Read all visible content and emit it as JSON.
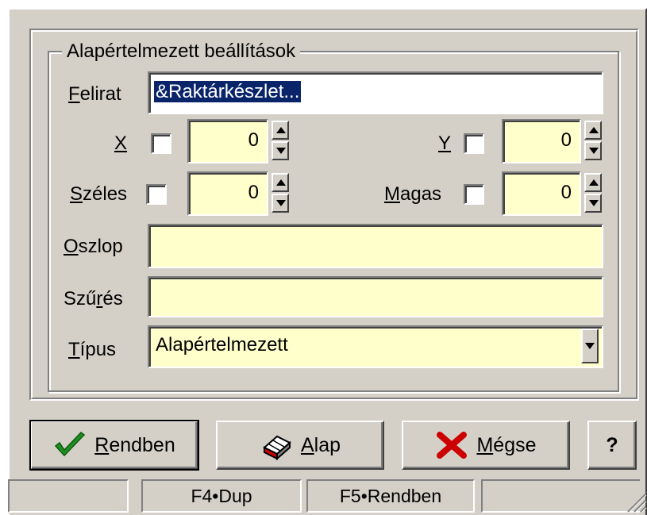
{
  "group": {
    "title": "Alapértelmezett beállítások"
  },
  "fields": {
    "felirat": {
      "label_underlined": "F",
      "label_rest": "elirat",
      "value": "&Raktárkészlet..."
    },
    "x": {
      "label_underlined": "X",
      "label_rest": "",
      "checked": false,
      "value": "0"
    },
    "y": {
      "label_underlined": "Y",
      "label_rest": "",
      "checked": false,
      "value": "0"
    },
    "szeles": {
      "label_underlined": "S",
      "label_rest": "zéles",
      "checked": false,
      "value": "0"
    },
    "magas": {
      "label_underlined": "M",
      "label_rest": "agas",
      "checked": false,
      "value": "0"
    },
    "oszlop": {
      "label_underlined": "O",
      "label_rest": "szlop",
      "value": ""
    },
    "szures": {
      "label_prefix": "Szű",
      "label_underlined": "r",
      "label_rest": "és",
      "value": ""
    },
    "tipus": {
      "label_underlined": "T",
      "label_rest": "ípus",
      "value": "Alapértelmezett"
    }
  },
  "buttons": {
    "ok": {
      "underlined": "R",
      "rest": "endben",
      "icon": "checkmark-icon"
    },
    "alap": {
      "underlined": "A",
      "rest": "lap",
      "icon": "eraser-icon"
    },
    "cancel": {
      "underlined": "M",
      "rest": "égse",
      "icon": "x-mark-icon"
    },
    "help": {
      "label": "?"
    }
  },
  "statusbar": {
    "cells": [
      "",
      "F4•Dup",
      "F5•Rendben",
      ""
    ]
  },
  "colors": {
    "field_bg": "#ffffcc",
    "face": "#d4d0c8",
    "check_green": "#1f8f1f",
    "cancel_red": "#cc0000",
    "selection": "#0a246a"
  }
}
